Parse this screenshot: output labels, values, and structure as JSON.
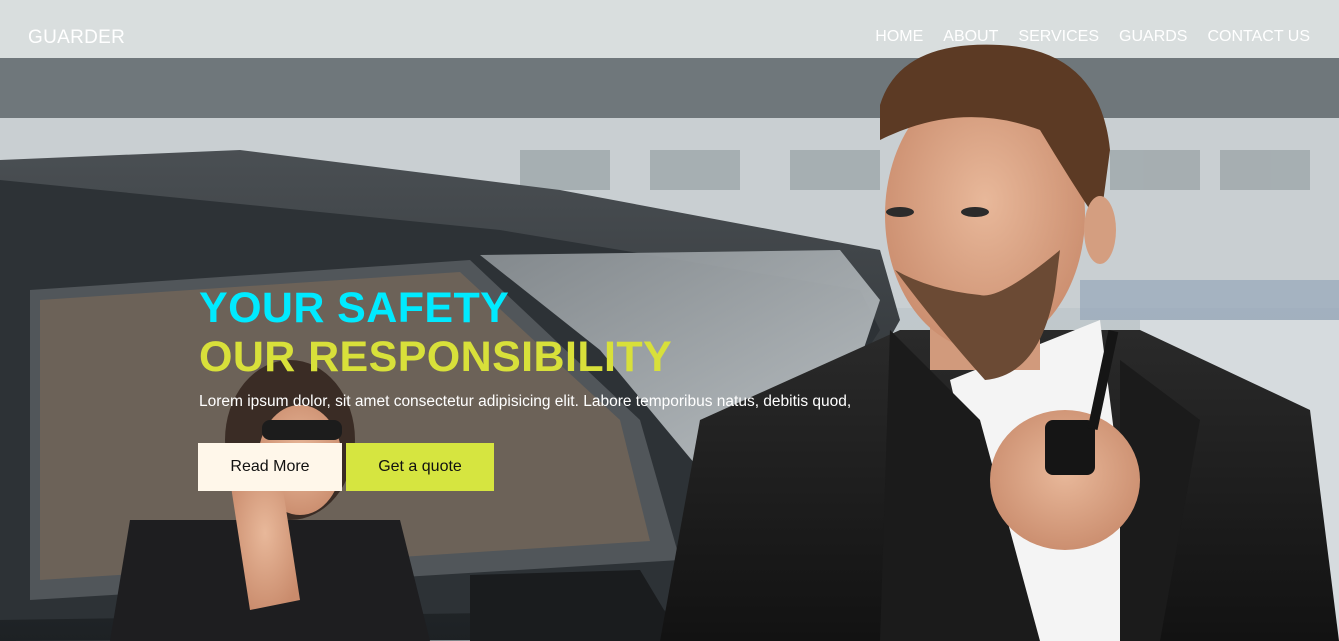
{
  "header": {
    "logo": "GUARDER",
    "nav": [
      "HOME",
      "ABOUT",
      "SERVICES",
      "GUARDS",
      "CONTACT US"
    ]
  },
  "hero": {
    "title_line1": "YOUR SAFETY",
    "title_line2": "OUR RESPONSIBILITY",
    "description": "Lorem ipsum dolor, sit amet consectetur adipisicing elit. Labore temporibus natus, debitis quod,",
    "read_more_label": "Read More",
    "quote_label": "Get a quote"
  },
  "colors": {
    "title_line1": "#00eaff",
    "title_line2": "#d8e03a",
    "read_more_bg": "#fff7ea",
    "quote_bg": "#d6e540"
  }
}
